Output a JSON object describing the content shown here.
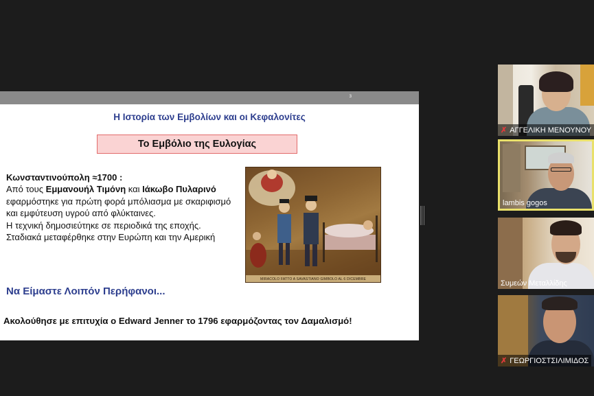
{
  "slide": {
    "page_number": "3",
    "title": "Η Ιστορία των Εμβολίων και οι Κεφαλονίτες",
    "subtitle": "Το Εμβόλιο της Ευλογίας",
    "body": {
      "heading": "Κωνσταντινούπολη ≈1700 :",
      "p1_a": "Από τους ",
      "p1_b": "Εμμανουήλ Τιμόνη",
      "p1_c": " και ",
      "p1_d": "Ιάκωβο Πυλαρινό",
      "p1_e": " εφαρμόστηκε για πρώτη φορά μπόλιασμα με σκαριφισμό και εμφύτευση υγρού από φλύκταινες.",
      "p2": "Η τεχνική δημοσιεύτηκε σε περιοδικά της εποχής.",
      "p3": "Σταδιακά μεταφέρθηκε στην Ευρώπη και την Αμερική"
    },
    "callout": "Να Είμαστε Λοιπόν Περήφανοι...",
    "footer": "Ακολούθησε με επιτυχία ο Edward Jenner το 1796 εφαρμόζοντας τον Δαμαλισμό!",
    "painting_caption": "MIRACOLO FATTO A SAVASTIANO GIMBOLO AL 6 DICEMBRE"
  },
  "participants": [
    {
      "name": "ΑΓΓΕΛΙΚΗ ΜΕΝΟΥΝΟΥ",
      "muted": true,
      "active": false
    },
    {
      "name": "lambis gogos",
      "muted": false,
      "active": true
    },
    {
      "name": "Συμεών Μεταλλίδης",
      "muted": false,
      "active": false
    },
    {
      "name": "ΓΕΩΡΓΙΟΣΤΣΙΛΙΜΙΔΟΣ",
      "muted": true,
      "active": false
    }
  ],
  "colors": {
    "background": "#1c1c1c",
    "slide_title": "#2d3e8e",
    "subtitle_fill": "#fad3d3",
    "subtitle_border": "#e26a6a",
    "active_speaker": "#e9e06a",
    "muted_icon": "#e23b3b"
  },
  "icons": {
    "muted": "mic-off-icon",
    "divider": "resize-handle-icon"
  }
}
